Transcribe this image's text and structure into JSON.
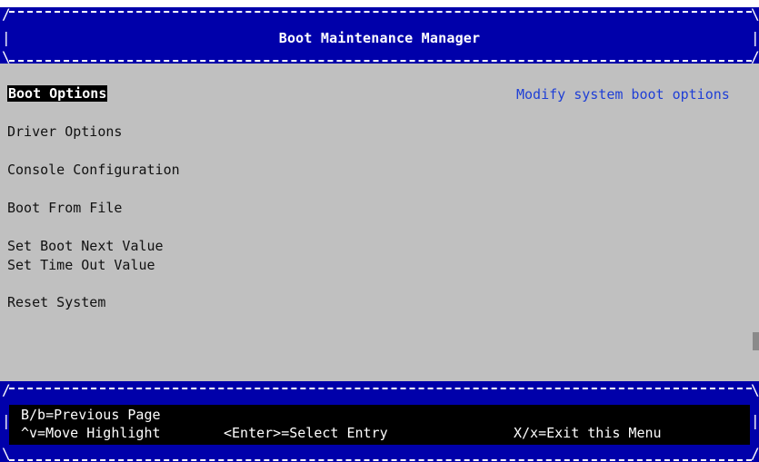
{
  "window": {
    "title": "Boot Maintenance Manager"
  },
  "menu": {
    "items": [
      {
        "label": "Boot Options",
        "selected": true
      },
      {
        "label": "Driver Options",
        "selected": false
      },
      {
        "label": "Console Configuration",
        "selected": false
      },
      {
        "label": "Boot From File",
        "selected": false
      },
      {
        "label": "Set Boot Next Value",
        "selected": false
      },
      {
        "label": "Set Time Out Value",
        "selected": false
      },
      {
        "label": "Reset System",
        "selected": false
      }
    ]
  },
  "help": {
    "text": "Modify system boot options"
  },
  "footer": {
    "prev_page": "B/b=Previous Page",
    "move_highlight": "^v=Move Highlight",
    "select_entry": "<Enter>=Select Entry",
    "exit_menu": "X/x=Exit this Menu"
  },
  "colors": {
    "background": "#c0c0c0",
    "bar": "#0000aa",
    "help_text": "#1f3fd6",
    "highlight": "#000000"
  },
  "icons": {
    "scroll_indicator": "scroll-thumb"
  }
}
